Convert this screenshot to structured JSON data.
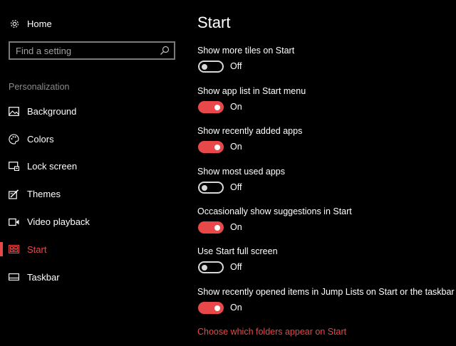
{
  "sidebar": {
    "home_label": "Home",
    "search_placeholder": "Find a setting",
    "section_label": "Personalization",
    "items": [
      {
        "label": "Background",
        "icon": "image-icon"
      },
      {
        "label": "Colors",
        "icon": "palette-icon"
      },
      {
        "label": "Lock screen",
        "icon": "lock-screen-icon"
      },
      {
        "label": "Themes",
        "icon": "themes-icon"
      },
      {
        "label": "Video playback",
        "icon": "video-icon"
      },
      {
        "label": "Start",
        "icon": "start-icon",
        "active": true
      },
      {
        "label": "Taskbar",
        "icon": "taskbar-icon"
      }
    ]
  },
  "main": {
    "title": "Start",
    "settings": [
      {
        "label": "Show more tiles on Start",
        "state": "Off"
      },
      {
        "label": "Show app list in Start menu",
        "state": "On"
      },
      {
        "label": "Show recently added apps",
        "state": "On"
      },
      {
        "label": "Show most used apps",
        "state": "Off"
      },
      {
        "label": "Occasionally show suggestions in Start",
        "state": "On"
      },
      {
        "label": "Use Start full screen",
        "state": "Off"
      },
      {
        "label": "Show recently opened items in Jump Lists on Start or the taskbar",
        "state": "On"
      }
    ],
    "link": "Choose which folders appear on Start"
  },
  "colors": {
    "accent": "#e8484a",
    "background": "#000000",
    "muted_text": "#8c8c8c"
  }
}
